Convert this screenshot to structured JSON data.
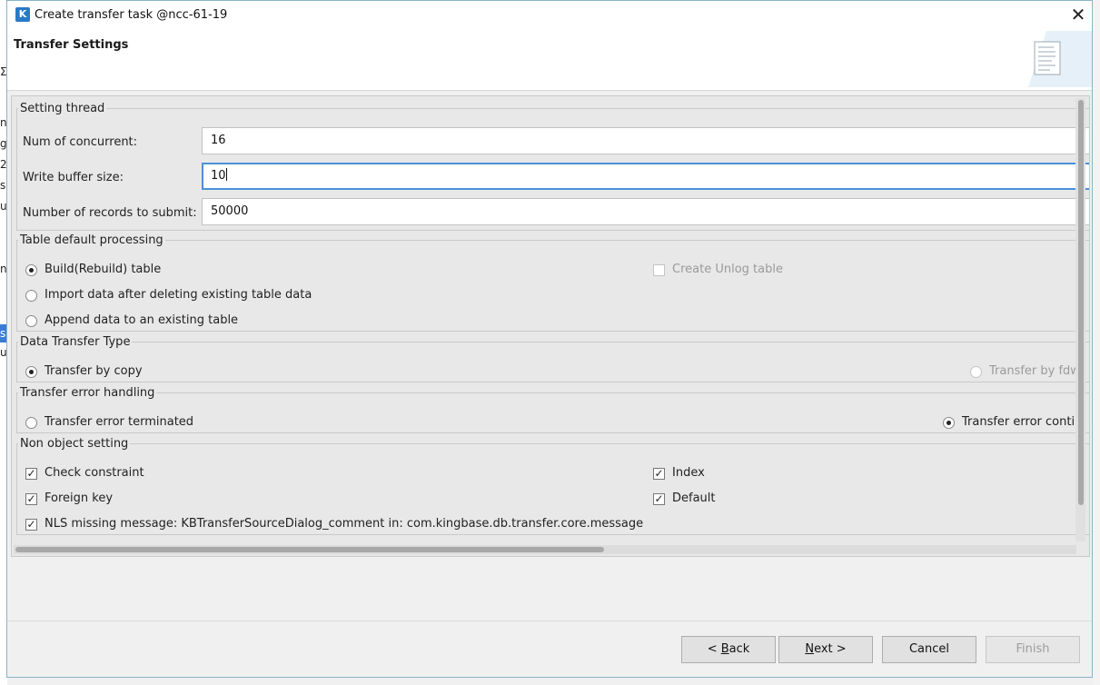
{
  "background_fragments": [
    "n",
    "g",
    "2",
    "s",
    "ul",
    "n",
    "s",
    "ul"
  ],
  "dialog": {
    "title": "Create transfer task @ncc-61-19",
    "close_symbol": "✕",
    "banner_title": "Transfer Settings"
  },
  "setting_thread": {
    "legend": "Setting thread",
    "concurrent_label": "Num of concurrent:",
    "concurrent_value": "16",
    "buffer_label": "Write buffer size:",
    "buffer_value": "10",
    "records_label": "Number of records to submit:",
    "records_value": "50000"
  },
  "table_processing": {
    "legend": "Table default processing",
    "options": [
      "Build(Rebuild) table",
      "Import data after deleting existing table data",
      "Append data to an existing table"
    ],
    "selected_index": 0,
    "unlog_label": "Create Unlog table",
    "unlog_checked": false
  },
  "transfer_type": {
    "legend": "Data Transfer Type",
    "copy_label": "Transfer by copy",
    "fdw_label": "Transfer by fdw",
    "selected": "copy"
  },
  "error_handling": {
    "legend": "Transfer error handling",
    "terminated_label": "Transfer error terminated",
    "continue_label": "Transfer error contin",
    "selected": "continue"
  },
  "non_object": {
    "legend": "Non object setting",
    "check_constraint": "Check constraint",
    "index": "Index",
    "foreign_key": "Foreign key",
    "default": "Default",
    "nls_message": "NLS missing message: KBTransferSourceDialog_comment in: com.kingbase.db.transfer.core.message"
  },
  "buttons": {
    "back_mnemonic": "B",
    "back_rest": "ack",
    "back_prefix": "< ",
    "next_mnemonic": "N",
    "next_rest": "ext >",
    "cancel": "Cancel",
    "finish": "Finish"
  },
  "colors": {
    "accent": "#4a90d9",
    "selected_bg": "#3a7bd5"
  }
}
